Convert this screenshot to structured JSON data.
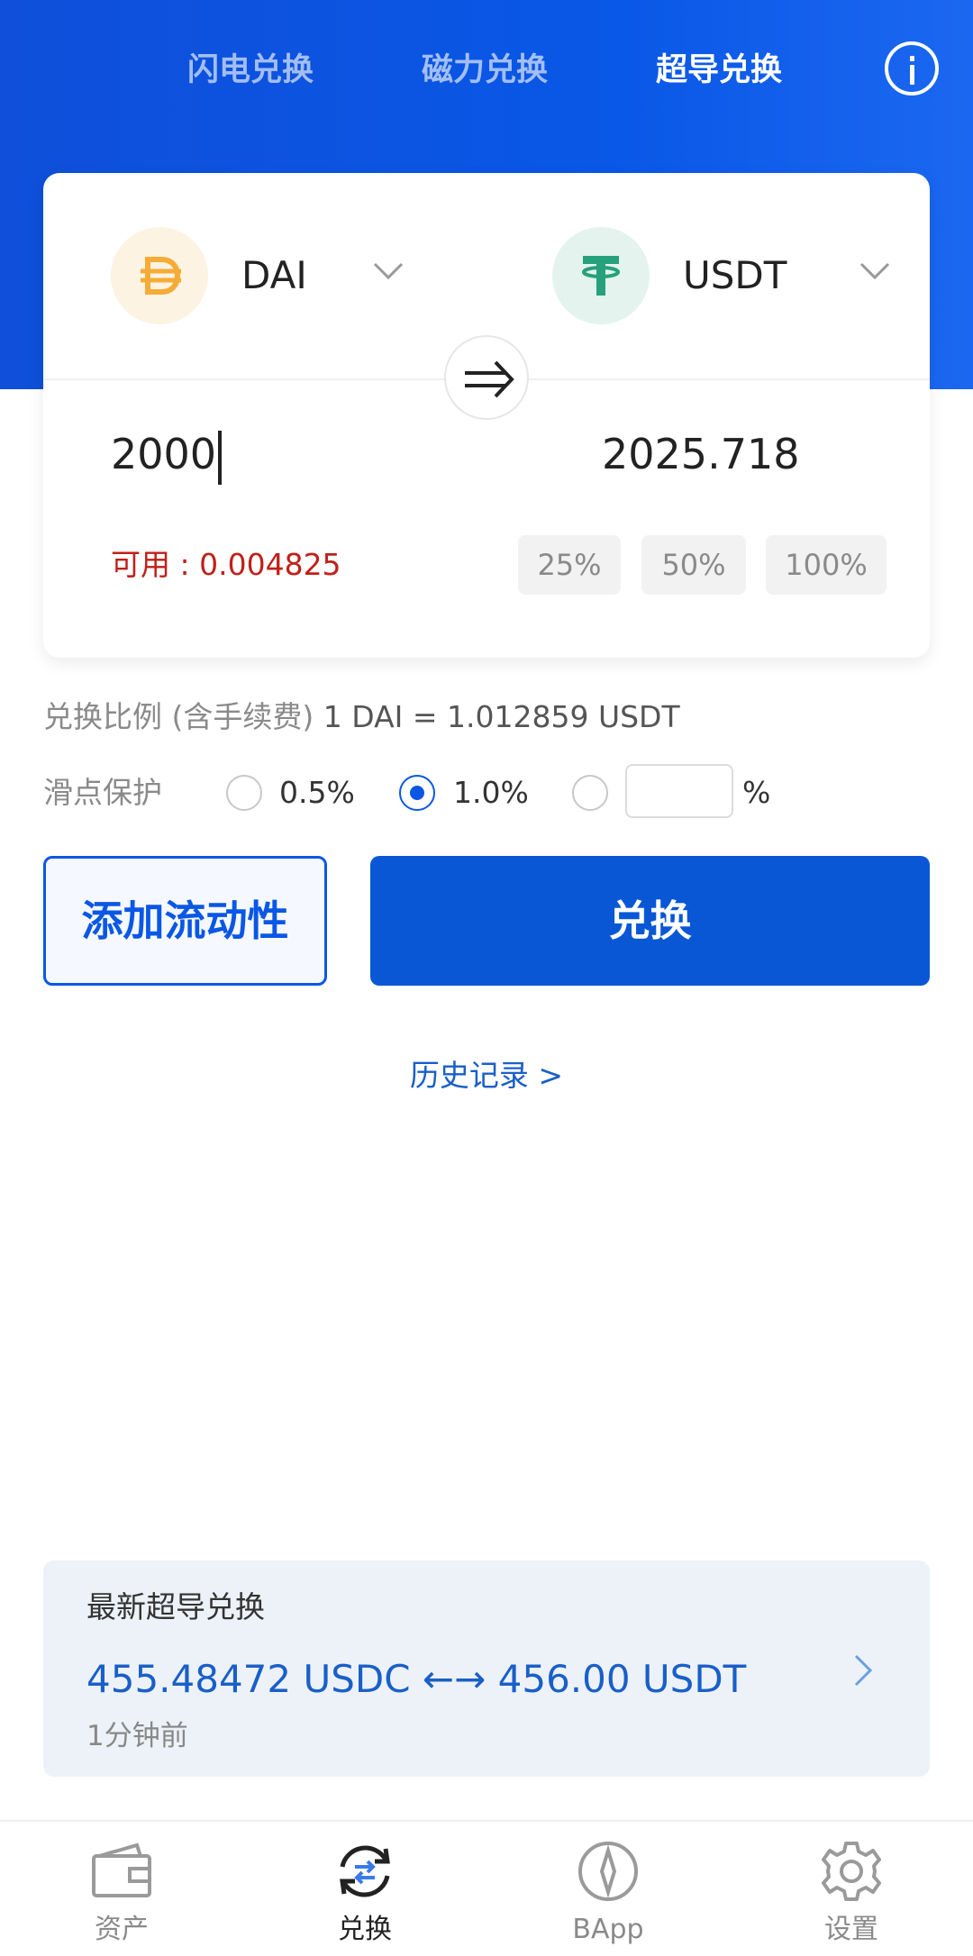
{
  "header": {
    "tabs": [
      {
        "label": "闪电兑换",
        "active": false
      },
      {
        "label": "磁力兑换",
        "active": false
      },
      {
        "label": "超导兑换",
        "active": true
      }
    ],
    "info_icon": "info-circle-icon"
  },
  "swap": {
    "from_token": {
      "symbol": "DAI",
      "icon": "dai-coin-icon",
      "color": "#f5ac37"
    },
    "to_token": {
      "symbol": "USDT",
      "icon": "usdt-coin-icon",
      "color": "#26a17b"
    },
    "amount_in": "2000",
    "amount_out": "2025.718",
    "available": "可用 : 0.004825",
    "percent_buttons": [
      "25%",
      "50%",
      "100%"
    ]
  },
  "rate": {
    "label": "兑换比例 (含手续费)",
    "value": "1 DAI = 1.012859 USDT"
  },
  "slippage": {
    "label": "滑点保护",
    "options": [
      "0.5%",
      "1.0%"
    ],
    "selected": "1.0%",
    "custom_value": "",
    "percent_sign": "%"
  },
  "buttons": {
    "add_liquidity": "添加流动性",
    "swap": "兑换"
  },
  "history_link": "历史记录 >",
  "latest": {
    "title": "最新超导兑换",
    "trade": "455.48472 USDC ←→ 456.00 USDT",
    "time": "1分钟前"
  },
  "nav": [
    {
      "label": "资产",
      "icon": "wallet-icon",
      "active": false
    },
    {
      "label": "兑换",
      "icon": "swap-icon",
      "active": true
    },
    {
      "label": "BApp",
      "icon": "compass-icon",
      "active": false
    },
    {
      "label": "设置",
      "icon": "gear-icon",
      "active": false
    }
  ],
  "colors": {
    "primary": "#0a57e6",
    "available_red": "#c0201a",
    "link_blue": "#1a5fc8"
  }
}
